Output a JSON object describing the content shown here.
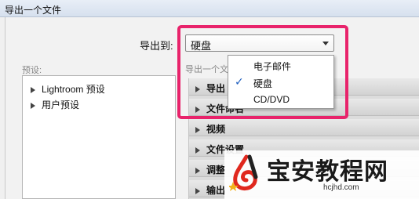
{
  "window": {
    "title": "导出一个文件"
  },
  "export": {
    "label": "导出到:",
    "selected": "硬盘",
    "options": [
      {
        "label": "电子邮件",
        "checked": false
      },
      {
        "label": "硬盘",
        "checked": true
      },
      {
        "label": "CD/DVD",
        "checked": false
      }
    ]
  },
  "presets": {
    "label": "预设:",
    "items": [
      "Lightroom 预设",
      "用户预设"
    ]
  },
  "right_panel": {
    "sublabel": "导出一个文",
    "sections": [
      "导出",
      "文件命名",
      "视频",
      "文件设置",
      "调整",
      "输出"
    ]
  },
  "watermark": {
    "title": "宝安教程网",
    "url": "hcjhd.com"
  },
  "colors": {
    "highlight": "#e8236b",
    "check": "#1f5fbf"
  }
}
